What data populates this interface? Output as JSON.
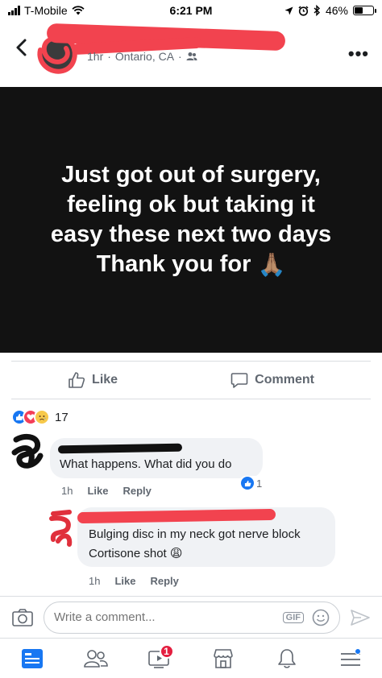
{
  "status_bar": {
    "carrier": "T-Mobile",
    "time": "6:21 PM",
    "battery_text": "46%",
    "battery_level": 0.46
  },
  "header": {
    "meta_time": "1hr",
    "meta_location": "Ontario, CA"
  },
  "post": {
    "text_lines": [
      "Just got out of surgery,",
      "feeling ok but taking it",
      "easy these next two days",
      "Thank you for"
    ],
    "text_emoji": "🙏🏽"
  },
  "actions": {
    "like_label": "Like",
    "comment_label": "Comment"
  },
  "reactions": {
    "count": "17",
    "types": [
      "like",
      "love",
      "sad"
    ]
  },
  "comments": [
    {
      "text": "What happens. What did you do",
      "time": "1h",
      "like_label": "Like",
      "reply_label": "Reply",
      "like_count": "1"
    },
    {
      "text_line1": "Bulging disc in my neck got nerve block",
      "text_line2": "Cortisone shot",
      "text_emoji": "😩",
      "time": "1h",
      "like_label": "Like",
      "reply_label": "Reply"
    }
  ],
  "composer": {
    "placeholder": "Write a comment...",
    "gif_label": "GIF"
  },
  "tabbar": {
    "video_badge": "1"
  },
  "colors": {
    "brand_blue": "#1877f2",
    "redaction": "#f2434f",
    "post_bg": "#121212",
    "badge_red": "#e41e3f"
  }
}
